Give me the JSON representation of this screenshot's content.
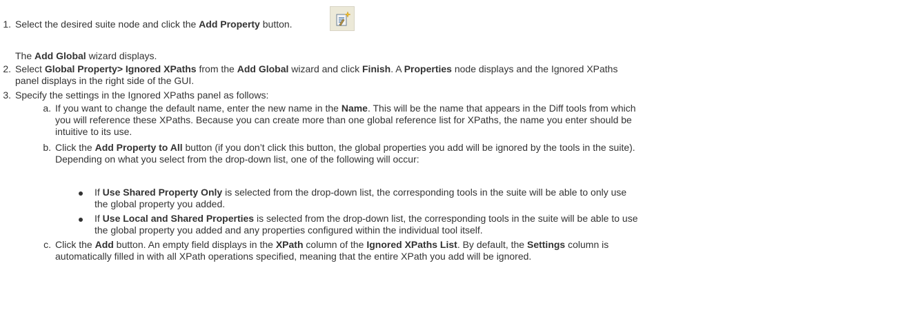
{
  "steps": [
    {
      "num": "1.",
      "pre": "Select the desired suite node and click the ",
      "b1": "Add Property",
      "post": " button.",
      "icon": "add-property-icon",
      "result_pre": "The ",
      "result_b": "Add Global",
      "result_post": " wizard displays."
    },
    {
      "num": "2.",
      "pre": "Select ",
      "b1": "Global Property> Ignored XPaths",
      "mid1": " from the ",
      "b2": "Add Global",
      "mid2": " wizard and click ",
      "b3": "Finish",
      "mid3": ". A ",
      "b4": "Properties",
      "mid4": " node displays and the Ignored XPaths",
      "line2": "panel displays in the right side of the GUI."
    },
    {
      "num": "3.",
      "text": "Specify the settings in the Ignored XPaths panel as follows:"
    }
  ],
  "substeps": {
    "a": {
      "num": "a.",
      "pre": "If you want to change the default name, enter the new name in the ",
      "b1": "Name",
      "post": ". This will be the name that appears in the Diff tools from which",
      "line2": "you will reference these XPaths. Because you can create more than one global reference list for XPaths, the name you enter should be",
      "line3": "intuitive to its use."
    },
    "b": {
      "num": "b.",
      "pre": "Click the ",
      "b1": "Add Property to All",
      "post": " button (if you don’t click this button, the global properties you add will be ignored by the tools in the suite).",
      "line2": "Depending on what you select from the drop-down list, one of the following will occur:",
      "bullets": [
        {
          "pre": "If ",
          "b": "Use Shared Property Only",
          "post": " is selected from the drop-down list, the corresponding tools in the suite will be able to only use",
          "line2": "the global property you added."
        },
        {
          "pre": "If ",
          "b": "Use Local and Shared Properties",
          "post": " is selected from the drop-down list, the corresponding tools in the suite will be able to use",
          "line2": "the global property you added and any properties configured within the individual tool itself."
        }
      ]
    },
    "c": {
      "num": "c.",
      "pre": "Click the ",
      "b1": "Add",
      "mid1": " button. An empty field displays in the ",
      "b2": "XPath",
      "mid2": " column of the ",
      "b3": "Ignored XPaths List",
      "mid3": ". By default, the ",
      "b4": "Settings",
      "post": " column is",
      "line2": "automatically filled in with all XPath operations specified, meaning that the entire XPath you add will be ignored."
    }
  }
}
